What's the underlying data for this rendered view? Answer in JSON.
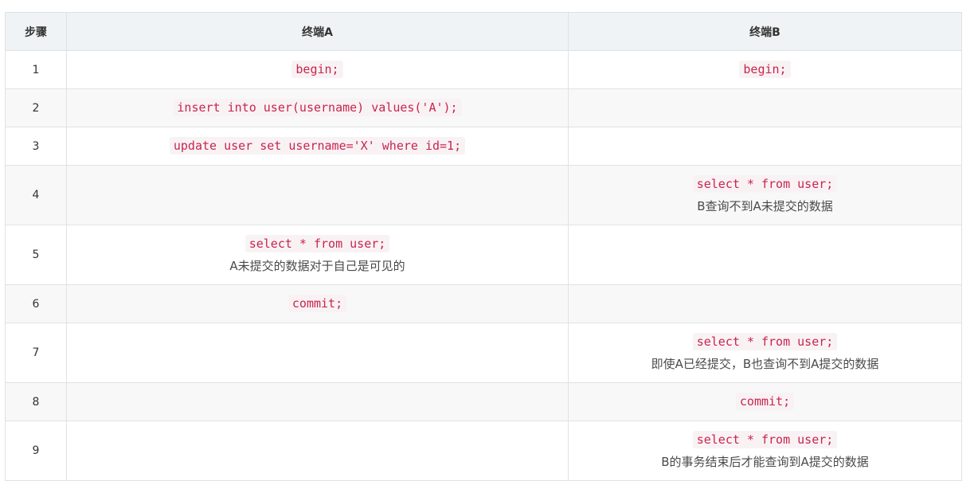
{
  "table": {
    "headers": [
      "步骤",
      "终端A",
      "终端B"
    ],
    "rows": [
      {
        "step": "1",
        "a_code": "begin;",
        "a_note": "",
        "b_code": "begin;",
        "b_note": ""
      },
      {
        "step": "2",
        "a_code": "insert into user(username) values('A');",
        "a_note": "",
        "b_code": "",
        "b_note": ""
      },
      {
        "step": "3",
        "a_code": "update user set username='X' where id=1;",
        "a_note": "",
        "b_code": "",
        "b_note": ""
      },
      {
        "step": "4",
        "a_code": "",
        "a_note": "",
        "b_code": "select * from user;",
        "b_note": "B查询不到A未提交的数据"
      },
      {
        "step": "5",
        "a_code": "select * from user;",
        "a_note": "A未提交的数据对于自己是可见的",
        "b_code": "",
        "b_note": ""
      },
      {
        "step": "6",
        "a_code": "commit;",
        "a_note": "",
        "b_code": "",
        "b_note": ""
      },
      {
        "step": "7",
        "a_code": "",
        "a_note": "",
        "b_code": "select * from user;",
        "b_note": "即使A已经提交，B也查询不到A提交的数据"
      },
      {
        "step": "8",
        "a_code": "",
        "a_note": "",
        "b_code": "commit;",
        "b_note": ""
      },
      {
        "step": "9",
        "a_code": "",
        "a_note": "",
        "b_code": "select * from user;",
        "b_note": "B的事务结束后才能查询到A提交的数据"
      }
    ]
  }
}
